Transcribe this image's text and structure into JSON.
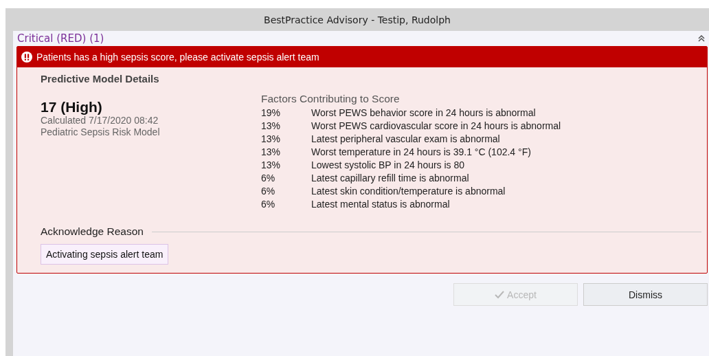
{
  "window": {
    "title": "BestPractice Advisory - Testip, Rudolph"
  },
  "section": {
    "title": "Critical (RED) (1)",
    "expanded": true
  },
  "alert": {
    "message": "Patients has a high sepsis score, please activate sepsis alert team"
  },
  "details": {
    "heading": "Predictive Model Details",
    "score": "17 (High)",
    "calculated": "Calculated 7/17/2020 08:42",
    "model": "Pediatric Sepsis Risk Model",
    "factors_title": "Factors Contributing to Score",
    "factors": [
      {
        "percent": "19%",
        "text": "Worst PEWS behavior score in 24 hours is abnormal"
      },
      {
        "percent": "13%",
        "text": "Worst PEWS cardiovascular score in 24 hours is abnormal"
      },
      {
        "percent": "13%",
        "text": "Latest peripheral vascular exam is abnormal"
      },
      {
        "percent": "13%",
        "text": "Worst temperature in 24 hours is 39.1 °C (102.4 °F)"
      },
      {
        "percent": "13%",
        "text": "Lowest systolic BP in 24 hours is 80"
      },
      {
        "percent": "6%",
        "text": "Latest capillary refill time is abnormal"
      },
      {
        "percent": "6%",
        "text": "Latest skin condition/temperature is abnormal"
      },
      {
        "percent": "6%",
        "text": "Latest mental status is abnormal"
      }
    ]
  },
  "acknowledge": {
    "label": "Acknowledge Reason",
    "options": [
      {
        "label": "Activating sepsis alert team",
        "selected": true
      }
    ]
  },
  "buttons": [
    {
      "label": "Accept",
      "kind": "accept",
      "disabled": true
    },
    {
      "label": "Dismiss",
      "kind": "dismiss",
      "disabled": false
    }
  ]
}
